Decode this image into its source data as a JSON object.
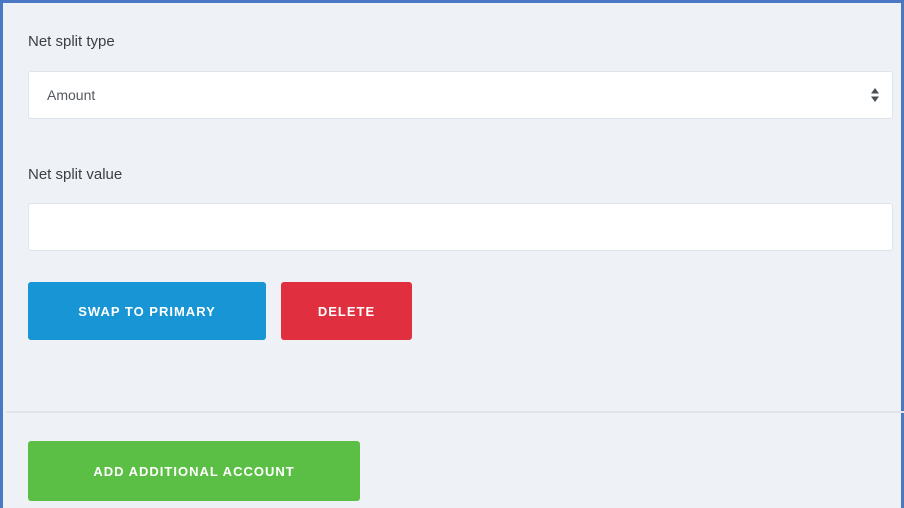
{
  "form": {
    "net_split_type_label": "Net split type",
    "net_split_type_value": "Amount",
    "net_split_value_label": "Net split value",
    "net_split_value_value": ""
  },
  "actions": {
    "swap_label": "SWAP TO PRIMARY",
    "delete_label": "DELETE",
    "add_account_label": "ADD ADDITIONAL ACCOUNT"
  },
  "icons": {
    "select_arrows": "up-down-caret-icon"
  },
  "colors": {
    "swap_button": "#1795d5",
    "delete_button": "#e0303f",
    "add_button": "#5cbf45",
    "frame_border": "#4a78c2"
  }
}
